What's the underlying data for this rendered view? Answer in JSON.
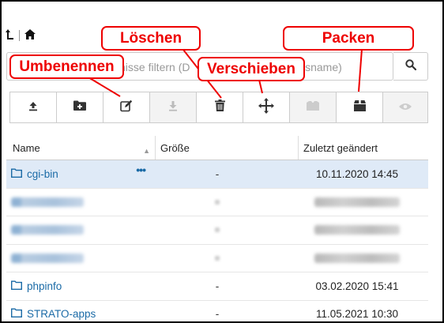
{
  "callouts": {
    "umbenennen": "Umbenennen",
    "loeschen": "Löschen",
    "verschieben": "Verschieben",
    "packen": "Packen"
  },
  "search": {
    "placeholder_left": "nisse filtern (D",
    "placeholder_right": "isname)"
  },
  "table": {
    "headers": {
      "name": "Name",
      "size": "Größe",
      "date": "Zuletzt geändert"
    },
    "rows": [
      {
        "name": "cgi-bin",
        "size": "-",
        "date": "10.11.2020 14:45",
        "selected": true,
        "blurred": false
      },
      {
        "name": "",
        "size": "",
        "date": "",
        "blurred": true
      },
      {
        "name": "",
        "size": "",
        "date": "",
        "blurred": true
      },
      {
        "name": "",
        "size": "",
        "date": "",
        "blurred": true
      },
      {
        "name": "phpinfo",
        "size": "-",
        "date": "03.02.2020 15:41",
        "blurred": false
      },
      {
        "name": "STRATO-apps",
        "size": "-",
        "date": "11.05.2021 10:30",
        "blurred": false
      }
    ]
  },
  "icons": {
    "home_up": "up-level-icon",
    "home": "home-icon",
    "search": "search-icon",
    "toolbar": [
      "upload-icon",
      "new-folder-icon",
      "rename-icon",
      "download-icon",
      "delete-icon",
      "move-icon",
      "extract-icon",
      "pack-icon",
      "view-icon"
    ]
  },
  "colors": {
    "callout": "#ee0000",
    "link": "#1a6aa6",
    "selected_row": "#dfeaf7"
  }
}
